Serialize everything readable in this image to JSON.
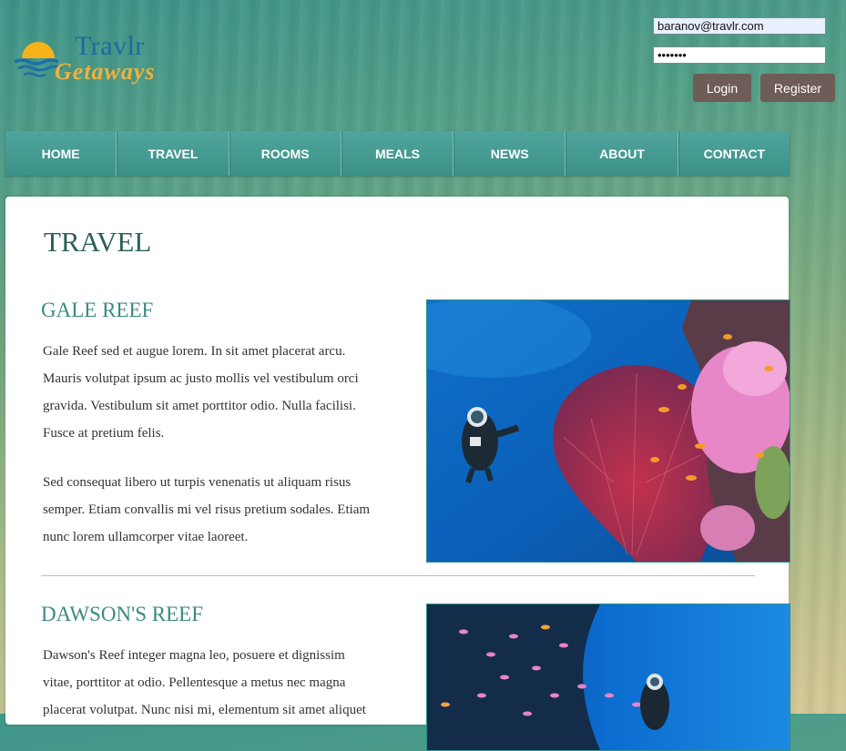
{
  "brand": {
    "name_top": "Travlr",
    "name_bottom": "Getaways"
  },
  "login": {
    "email": "baranov@travlr.com",
    "password_masked": "•••••••",
    "login_label": "Login",
    "register_label": "Register"
  },
  "nav": {
    "items": [
      "HOME",
      "TRAVEL",
      "ROOMS",
      "MEALS",
      "NEWS",
      "ABOUT",
      "CONTACT"
    ]
  },
  "page": {
    "title": "TRAVEL",
    "sections": [
      {
        "heading": "GALE REEF",
        "paragraphs": [
          "Gale Reef sed et augue lorem. In sit amet placerat arcu. Mauris volutpat ipsum ac justo mollis vel vestibulum orci gravida. Vestibulum sit amet porttitor odio. Nulla facilisi. Fusce at pretium felis.",
          "Sed consequat libero ut turpis venenatis ut aliquam risus semper. Etiam convallis mi vel risus pretium sodales. Etiam nunc lorem ullamcorper vitae laoreet."
        ]
      },
      {
        "heading": "DAWSON'S REEF",
        "paragraphs": [
          "Dawson's Reef integer magna leo, posuere et dignissim vitae, porttitor at odio. Pellentesque a metus nec magna placerat volutpat. Nunc nisi mi, elementum sit amet aliquet"
        ]
      }
    ]
  },
  "colors": {
    "nav": "#3c9188",
    "button": "#6e5d56",
    "heading": "#3a8a84",
    "title": "#2c5f5a"
  }
}
